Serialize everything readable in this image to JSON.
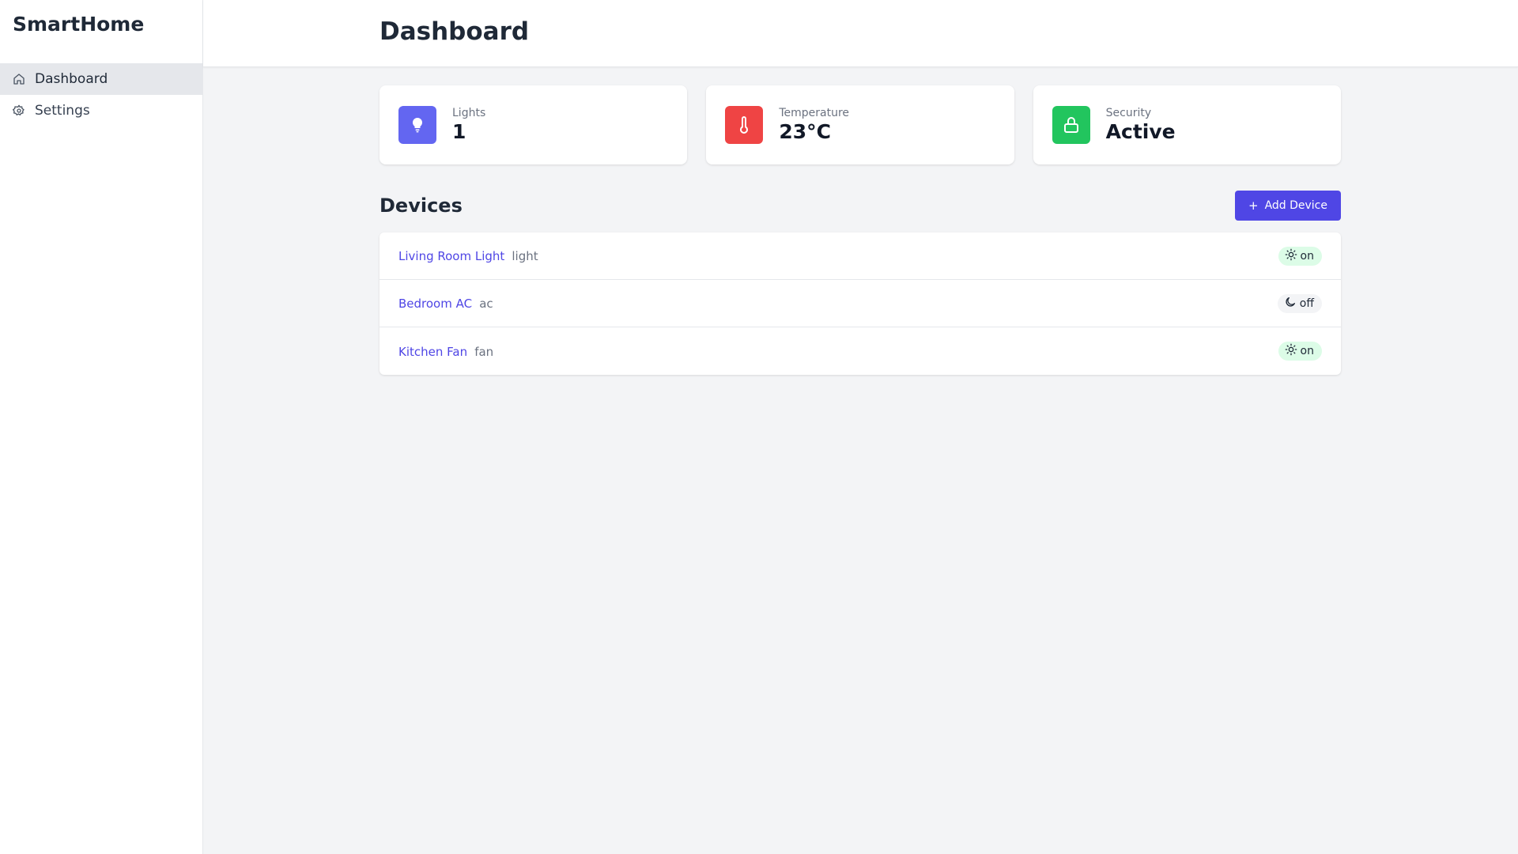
{
  "app": {
    "brand": "SmartHome"
  },
  "sidebar": {
    "items": [
      {
        "label": "Dashboard",
        "icon": "home-icon",
        "active": true
      },
      {
        "label": "Settings",
        "icon": "gear-icon",
        "active": false
      }
    ]
  },
  "header": {
    "title": "Dashboard"
  },
  "stats": [
    {
      "label": "Lights",
      "value": "1",
      "icon": "lightbulb-icon",
      "color": "#6366f1"
    },
    {
      "label": "Temperature",
      "value": "23°C",
      "icon": "thermometer-icon",
      "color": "#ef4444"
    },
    {
      "label": "Security",
      "value": "Active",
      "icon": "lock-icon",
      "color": "#22c55e"
    }
  ],
  "devices": {
    "title": "Devices",
    "add_label": "Add Device",
    "add_color": "#4f46e5",
    "list": [
      {
        "name": "Living Room Light",
        "type": "light",
        "status": "on",
        "status_icon": "sun-icon"
      },
      {
        "name": "Bedroom AC",
        "type": "ac",
        "status": "off",
        "status_icon": "moon-icon"
      },
      {
        "name": "Kitchen Fan",
        "type": "fan",
        "status": "on",
        "status_icon": "sun-icon"
      }
    ]
  }
}
